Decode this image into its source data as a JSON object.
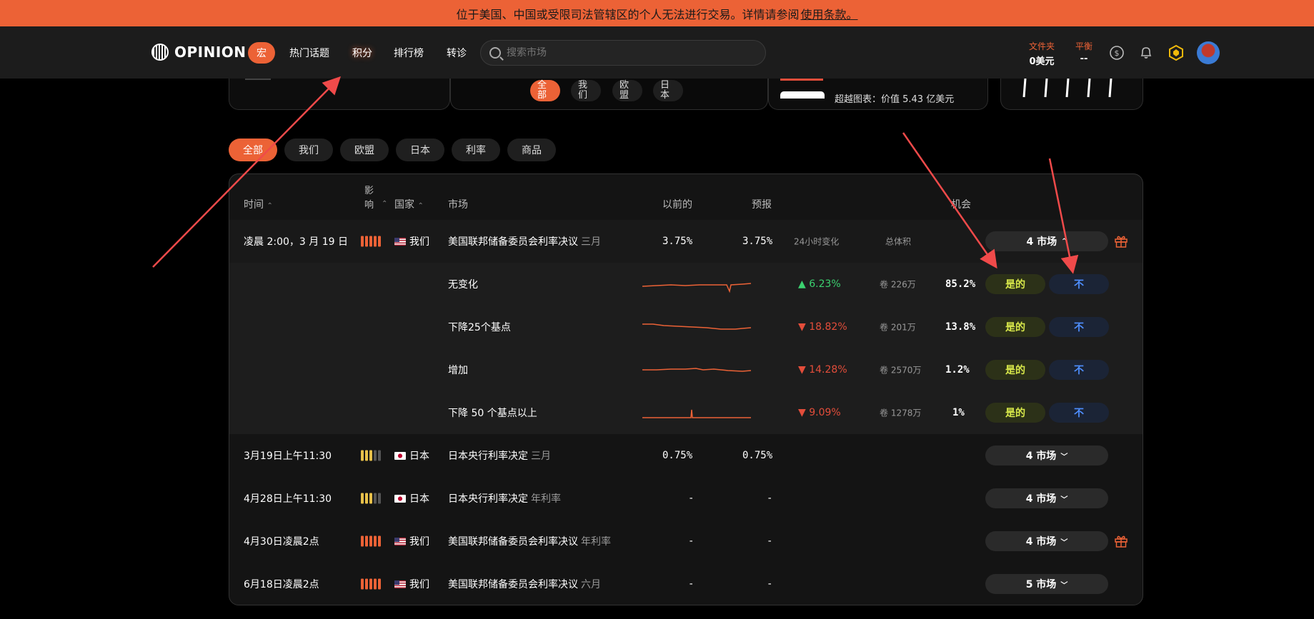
{
  "banner": {
    "text": "位于美国、中国或受限司法管辖区的个人无法进行交易。详情请参阅",
    "link": "使用条款。"
  },
  "nav": {
    "logo": "OPINION",
    "items": [
      "宏",
      "热门话题",
      "积分",
      "排行榜",
      "转诊"
    ],
    "search_placeholder": "搜索市场",
    "portfolio_label": "文件夹",
    "portfolio_value": "0美元",
    "balance_label": "平衡",
    "balance_value": "--"
  },
  "topcards": {
    "chips": [
      "全部",
      "我们",
      "欧盟",
      "日本"
    ],
    "news": "超越图表：价值 5.43 亿美元"
  },
  "filters": [
    "全部",
    "我们",
    "欧盟",
    "日本",
    "利率",
    "商品"
  ],
  "table": {
    "headers": {
      "time": "时间",
      "impact": "影响",
      "country": "国家",
      "market": "市场",
      "previous": "以前的",
      "forecast": "预报",
      "chance": "机会"
    },
    "sub_headers": {
      "change": "24小时变化",
      "volume": "总体积"
    },
    "rows": [
      {
        "time": "凌晨 2:00，3 月 19 日",
        "impact": 5,
        "impact_color": "#ec6236",
        "country": "我们",
        "flag": "us",
        "market": "美国联邦储备委员会利率决议",
        "tag": "三月",
        "previous": "3.75%",
        "forecast": "3.75%",
        "markets": "4 市场",
        "gift": true,
        "expanded": true
      },
      {
        "time": "3月19日上午11:30",
        "impact": 3,
        "impact_color": "#e8c14a",
        "country": "日本",
        "flag": "jp",
        "market": "日本央行利率决定",
        "tag": "三月",
        "previous": "0.75%",
        "forecast": "0.75%",
        "markets": "4 市场",
        "gift": false
      },
      {
        "time": "4月28日上午11:30",
        "impact": 3,
        "impact_color": "#e8c14a",
        "country": "日本",
        "flag": "jp",
        "market": "日本央行利率决定",
        "tag": "年利率",
        "previous": "-",
        "forecast": "-",
        "markets": "4 市场",
        "gift": false
      },
      {
        "time": "4月30日凌晨2点",
        "impact": 5,
        "impact_color": "#ec6236",
        "country": "我们",
        "flag": "us",
        "market": "美国联邦储备委员会利率决议",
        "tag": "年利率",
        "previous": "-",
        "forecast": "-",
        "markets": "4 市场",
        "gift": true
      },
      {
        "time": "6月18日凌晨2点",
        "impact": 5,
        "impact_color": "#ec6236",
        "country": "我们",
        "flag": "us",
        "market": "美国联邦储备委员会利率决议",
        "tag": "六月",
        "previous": "-",
        "forecast": "-",
        "markets": "5 市场",
        "gift": false
      }
    ],
    "outcomes": [
      {
        "name": "无变化",
        "dir": "up",
        "change": "6.23%",
        "volume": "卷 226万",
        "chance": "85.2%",
        "yes": "是的",
        "no": "不"
      },
      {
        "name": "下降25个基点",
        "dir": "down",
        "change": "18.82%",
        "volume": "卷 201万",
        "chance": "13.8%",
        "yes": "是的",
        "no": "不"
      },
      {
        "name": "增加",
        "dir": "down",
        "change": "14.28%",
        "volume": "卷 2570万",
        "chance": "1.2%",
        "yes": "是的",
        "no": "不"
      },
      {
        "name": "下降 50 个基点以上",
        "dir": "down",
        "change": "9.09%",
        "volume": "卷 1278万",
        "chance": "1%",
        "yes": "是的",
        "no": "不"
      }
    ]
  },
  "colors": {
    "accent": "#ec6236",
    "yes": "#d8e84a",
    "no": "#4f8fff",
    "up": "#3bd16f",
    "down": "#e34d3a"
  }
}
